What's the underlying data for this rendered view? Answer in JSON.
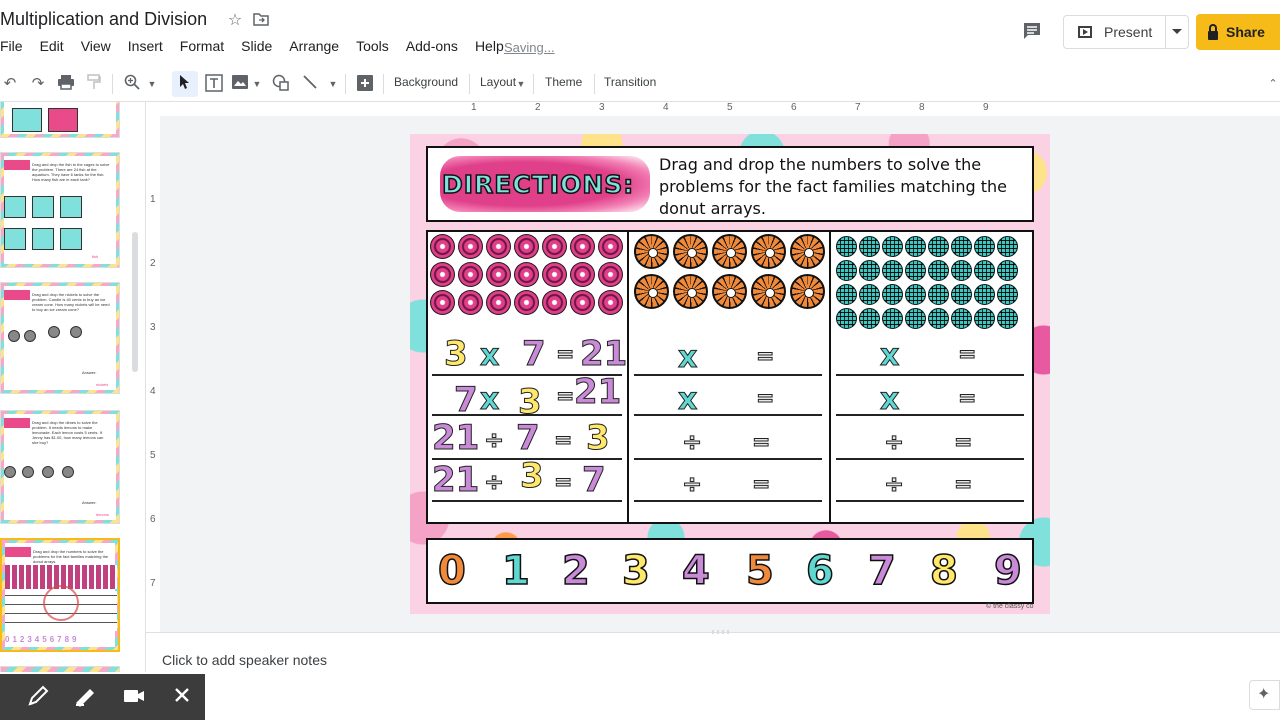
{
  "title": "Multiplication and Division",
  "menu": [
    "File",
    "Edit",
    "View",
    "Insert",
    "Format",
    "Slide",
    "Arrange",
    "Tools",
    "Add-ons",
    "Help"
  ],
  "saving_status": "Saving...",
  "header": {
    "present_label": "Present",
    "share_label": "Share"
  },
  "toolbar": {
    "background_label": "Background",
    "layout_label": "Layout",
    "theme_label": "Theme",
    "transition_label": "Transition"
  },
  "ruler_h": [
    "1",
    "2",
    "3",
    "4",
    "5",
    "6",
    "7",
    "8",
    "9"
  ],
  "ruler_v": [
    "1",
    "2",
    "3",
    "4",
    "5",
    "6",
    "7"
  ],
  "filmstrip": {
    "slide1_text": "Drag and drop the fish to the cages to solve the problem. There are 24 fish at the aquarium. They have 6 tanks for the fish. How many fish are in each tank?",
    "slide1_answer": "fish",
    "slide2_text": "Drag and drop the nickels to solve the problem. Candle is 40 cents to buy an ice cream cone. How many nickels will he need to buy an ice cream cone?",
    "slide2_answer": "nickels",
    "slide3_text": "Drag and drop the dimes to solve the problem. It needs lemons to make lemonade. Each lemon costs 5 cents. If Jenny has $1.00, how many lemons can she buy?",
    "slide3_answer": "lemons",
    "slide4_text": "Drag and drop the numbers to solve the problems for the fact families matching the donut arrays.",
    "answer_label": "Answer:"
  },
  "slide": {
    "directions_title": "DIRECTIONS:",
    "directions_text": "Drag and drop the numbers to solve the problems for the fact families matching the donut arrays.",
    "col1": [
      [
        "3",
        "x",
        "7",
        "=",
        "21"
      ],
      [
        "7",
        "x",
        "3",
        "=",
        "21"
      ],
      [
        "21",
        "÷",
        "7",
        "=",
        "3"
      ],
      [
        "21",
        "÷",
        "3",
        "=",
        "7"
      ]
    ],
    "col2": [
      [
        "x",
        "="
      ],
      [
        "x",
        "="
      ],
      [
        "÷",
        "="
      ],
      [
        "÷",
        "="
      ]
    ],
    "col3": [
      [
        "x",
        "="
      ],
      [
        "x",
        "="
      ],
      [
        "÷",
        "="
      ],
      [
        "÷",
        "="
      ]
    ],
    "number_bank": [
      "0",
      "1",
      "2",
      "3",
      "4",
      "5",
      "6",
      "7",
      "8",
      "9"
    ],
    "number_colors": [
      "#f08a3a",
      "#5fd8d2",
      "#c98ad8",
      "#ffe86a",
      "#c98ad8",
      "#f08a3a",
      "#5fd8d2",
      "#c98ad8",
      "#ffe86a",
      "#c98ad8"
    ],
    "credit": "© the classy co"
  },
  "notes_placeholder": "Click to add speaker notes"
}
